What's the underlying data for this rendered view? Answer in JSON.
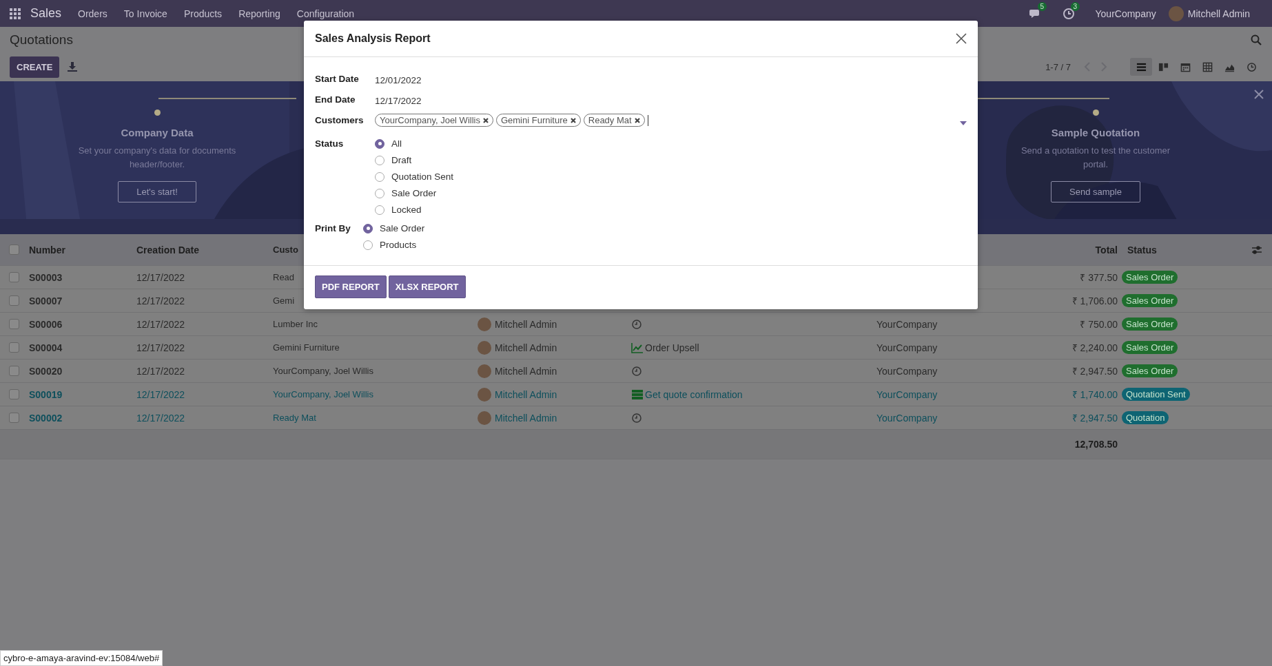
{
  "navbar": {
    "app_name": "Sales",
    "menu": [
      "Orders",
      "To Invoice",
      "Products",
      "Reporting",
      "Configuration"
    ],
    "messages_badge": "5",
    "activities_badge": "3",
    "company": "YourCompany",
    "user": "Mitchell Admin"
  },
  "control_panel": {
    "title": "Quotations",
    "create_button": "CREATE",
    "pager": "1-7 / 7",
    "views": [
      {
        "kind": "list",
        "selected": true
      },
      {
        "kind": "kanban",
        "selected": false
      },
      {
        "kind": "calendar",
        "selected": false
      },
      {
        "kind": "pivot",
        "selected": false
      },
      {
        "kind": "graph",
        "selected": false
      },
      {
        "kind": "activity",
        "selected": false
      }
    ]
  },
  "banner": {
    "steps": [
      {
        "title": "Company Data",
        "description": "Set your company's data for documents header/footer.",
        "button": "Let's start!"
      },
      {
        "title": "Sample Quotation",
        "description": "Send a quotation to test the customer portal.",
        "button": "Send sample"
      }
    ]
  },
  "table": {
    "select_all_checked": false,
    "columns": [
      "Number",
      "Creation Date",
      "Custo",
      "Total",
      "Status"
    ],
    "rows": [
      {
        "checked": false,
        "highlighted": false,
        "number": "S00003",
        "date": "12/17/2022",
        "customer": "Read",
        "total": "₹ 377.50",
        "status": {
          "label": "Sales Order",
          "color": "#1f6e2e"
        }
      },
      {
        "checked": false,
        "highlighted": false,
        "number": "S00007",
        "date": "12/17/2022",
        "customer": "Gemi",
        "total": "₹ 1,706.00",
        "status": {
          "label": "Sales Order",
          "color": "#1f6e2e"
        }
      },
      {
        "checked": false,
        "highlighted": false,
        "number": "S00006",
        "date": "12/17/2022",
        "customer": "Lumber Inc",
        "salesperson": "Mitchell Admin",
        "activity": {
          "kind": "clock"
        },
        "company": "YourCompany",
        "total": "₹ 750.00",
        "status": {
          "label": "Sales Order",
          "color": "#1f6e2e"
        }
      },
      {
        "checked": false,
        "highlighted": false,
        "number": "S00004",
        "date": "12/17/2022",
        "customer": "Gemini Furniture",
        "salesperson": "Mitchell Admin",
        "activity": {
          "kind": "chart",
          "text": "Order Upsell"
        },
        "company": "YourCompany",
        "total": "₹ 2,240.00",
        "status": {
          "label": "Sales Order",
          "color": "#1f6e2e"
        }
      },
      {
        "checked": false,
        "highlighted": false,
        "number": "S00020",
        "date": "12/17/2022",
        "customer": "YourCompany, Joel Willis",
        "salesperson": "Mitchell Admin",
        "activity": {
          "kind": "clock"
        },
        "company": "YourCompany",
        "total": "₹ 2,947.50",
        "status": {
          "label": "Sales Order",
          "color": "#1f6e2e"
        }
      },
      {
        "checked": false,
        "highlighted": true,
        "number": "S00019",
        "date": "12/17/2022",
        "customer": "YourCompany, Joel Willis",
        "salesperson": "Mitchell Admin",
        "activity": {
          "kind": "list",
          "text": "Get quote confirmation"
        },
        "company": "YourCompany",
        "total": "₹ 1,740.00",
        "status": {
          "label": "Quotation Sent",
          "color": "#0e6473"
        }
      },
      {
        "checked": false,
        "highlighted": true,
        "number": "S00002",
        "date": "12/17/2022",
        "customer": "Ready Mat",
        "salesperson": "Mitchell Admin",
        "activity": {
          "kind": "clock"
        },
        "company": "YourCompany",
        "total": "₹ 2,947.50",
        "status": {
          "label": "Quotation",
          "color": "#0e6473"
        }
      }
    ],
    "footer_total": "12,708.50"
  },
  "dialog": {
    "title": "Sales Analysis Report",
    "start_date_label": "Start Date",
    "start_date": "12/01/2022",
    "end_date_label": "End Date",
    "end_date": "12/17/2022",
    "customers_label": "Customers",
    "customers": [
      "YourCompany, Joel Willis",
      "Gemini Furniture",
      "Ready Mat"
    ],
    "status_label": "Status",
    "status_options": [
      {
        "label": "All",
        "selected": true
      },
      {
        "label": "Draft",
        "selected": false
      },
      {
        "label": "Quotation Sent",
        "selected": false
      },
      {
        "label": "Sale Order",
        "selected": false
      },
      {
        "label": "Locked",
        "selected": false
      }
    ],
    "print_by_label": "Print By",
    "print_by_options": [
      {
        "label": "Sale Order",
        "selected": true
      },
      {
        "label": "Products",
        "selected": false
      }
    ],
    "buttons": [
      "PDF REPORT",
      "XLSX REPORT"
    ]
  },
  "status_url": "cybro-e-amaya-aravind-ev:15084/web#"
}
